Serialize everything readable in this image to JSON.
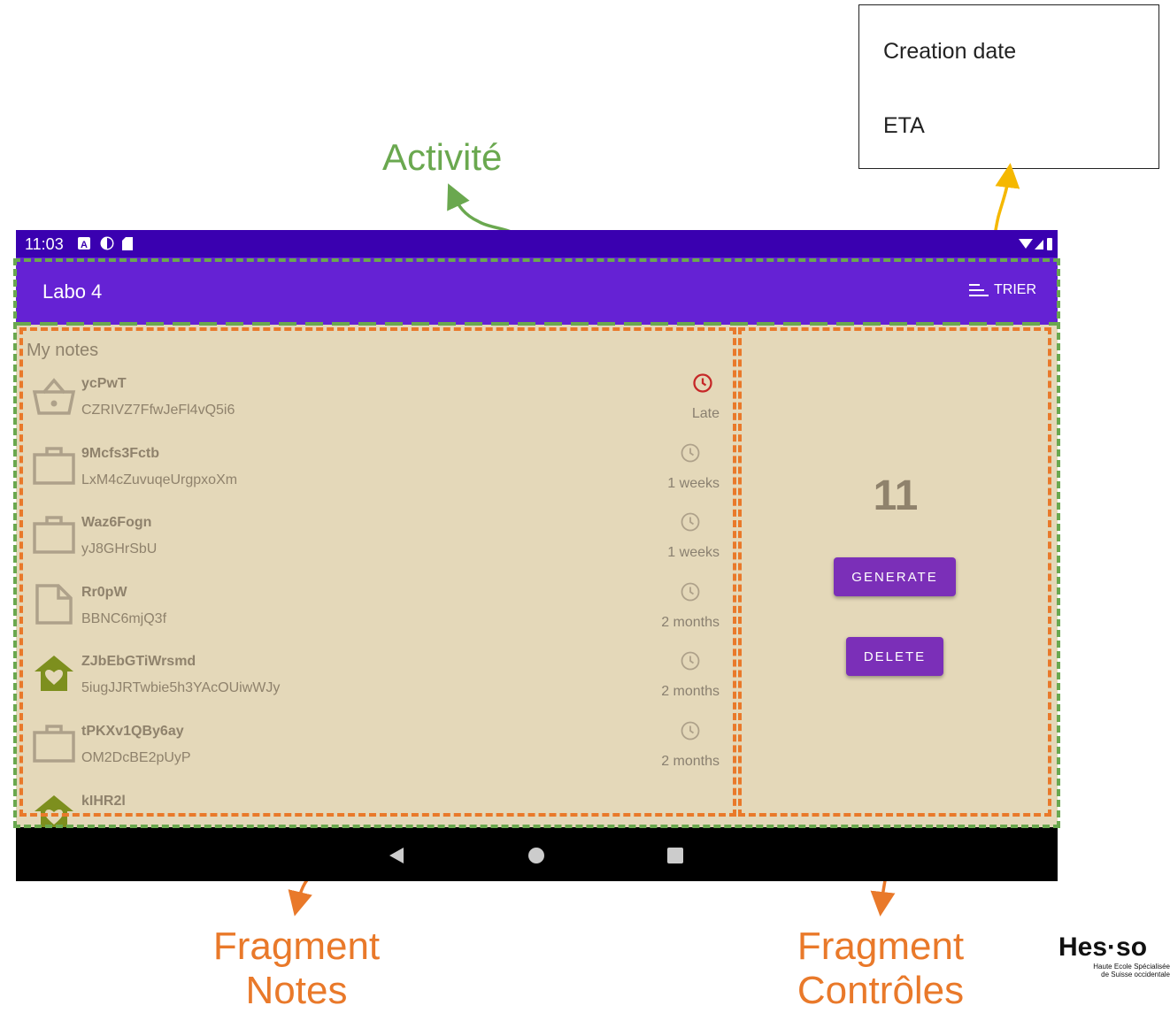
{
  "sort_menu": {
    "items": [
      "Creation date",
      "ETA"
    ]
  },
  "annotations": {
    "activity": "Activité",
    "fragment_notes": [
      "Fragment",
      "Notes"
    ],
    "fragment_controls": [
      "Fragment",
      "Contrôles"
    ]
  },
  "status_bar": {
    "time": "11:03"
  },
  "app_bar": {
    "title": "Labo 4",
    "sort_label": "TRIER"
  },
  "notes_fragment": {
    "header": "My notes",
    "notes": [
      {
        "title": "ycPwT",
        "text": "CZRIVZ7FfwJeFl4vQ5i6",
        "eta": "Late",
        "icon": "shopping-basket-icon",
        "late": true
      },
      {
        "title": "9Mcfs3Fctb",
        "text": "LxM4cZuvuqeUrgpxoXm",
        "eta": "1 weeks",
        "icon": "briefcase-icon",
        "late": false
      },
      {
        "title": "Waz6Fogn",
        "text": "yJ8GHrSbU",
        "eta": "1 weeks",
        "icon": "briefcase-icon",
        "late": false
      },
      {
        "title": "Rr0pW",
        "text": "BBNC6mjQ3f",
        "eta": "2 months",
        "icon": "document-icon",
        "late": false
      },
      {
        "title": "ZJbEbGTiWrsmd",
        "text": "5iugJJRTwbie5h3YAcOUiwWJy",
        "eta": "2 months",
        "icon": "home-heart-icon",
        "late": false
      },
      {
        "title": "tPKXv1QBy6ay",
        "text": "OM2DcBE2pUyP",
        "eta": "2 months",
        "icon": "briefcase-icon",
        "late": false
      },
      {
        "title": "kIHR2l",
        "text": "",
        "eta": "",
        "icon": "home-heart-icon",
        "late": false
      }
    ]
  },
  "controls_fragment": {
    "count": "11",
    "generate_label": "GENERATE",
    "delete_label": "DELETE"
  },
  "logo": {
    "brand": "Hes·so",
    "line1": "Haute Ecole Spécialisée",
    "line2": "de Suisse occidentale"
  },
  "colors": {
    "status_bar": "#3a00b0",
    "app_bar": "#6522d4",
    "content_bg": "#e4d8b9",
    "button": "#7b2fb8",
    "annotation_green": "#6aa84f",
    "annotation_orange": "#e9792a",
    "late_red": "#c62828"
  }
}
